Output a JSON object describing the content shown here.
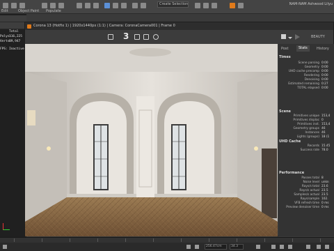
{
  "max": {
    "menu": [
      "Edit",
      "Object Paint",
      "Populate"
    ],
    "selection_set": "Create Selection Se",
    "title_right": "NAM-NAM  Ashwood  Lilyu",
    "stats": {
      "header": "Total",
      "polys_label": "Polys:",
      "polys_value": "116,225",
      "verts_label": "Verts:",
      "verts_value": "89,947",
      "fps_label": "FPS:",
      "fps_value": "Inactive"
    }
  },
  "vfb": {
    "title": "Corona 13 (Hotfix 1) | 1920x1440px (1:1) | Camera: CoronaCamera001 | Frame 0",
    "toolbar_number": "3",
    "channel": "BEAUTY",
    "tabs": [
      "Post",
      "Stats",
      "History"
    ],
    "active_tab": "Stats",
    "sections": {
      "times": {
        "title": "Times",
        "rows": [
          {
            "k": "Scene parsing",
            "v": "0:00"
          },
          {
            "k": "Geometry",
            "v": "0:00"
          },
          {
            "k": "UHD cache precomp",
            "v": "0:00"
          },
          {
            "k": "Rendering",
            "v": "0:00"
          },
          {
            "k": "Denoising",
            "v": "0:00"
          },
          {
            "k": "Estimated remaining",
            "v": "0:27"
          },
          {
            "k": "TOTAL elapsed",
            "v": "0:00"
          }
        ]
      },
      "scene": {
        "title": "Scene",
        "rows": [
          {
            "k": "Primitives unique",
            "v": "153,4"
          },
          {
            "k": "Primitives displac",
            "v": "0"
          },
          {
            "k": "Primitives inst.",
            "v": "153,4"
          },
          {
            "k": "Geometry groups",
            "v": "46"
          },
          {
            "k": "Instances",
            "v": "46"
          },
          {
            "k": "Lights (groups)",
            "v": "18 (1"
          }
        ]
      },
      "uhd": {
        "title": "UHD Cache",
        "rows": [
          {
            "k": "Records",
            "v": "15.45"
          },
          {
            "k": "Success rate",
            "v": "78.0"
          }
        ]
      },
      "performance": {
        "title": "Performance",
        "rows": [
          {
            "k": "Passes total",
            "v": "8"
          },
          {
            "k": "Noise level",
            "v": "unkn"
          },
          {
            "k": "Rays/s total",
            "v": "23.6"
          },
          {
            "k": "Rays/s actual",
            "v": "23.5"
          },
          {
            "k": "Samples/s actual",
            "v": "23.5"
          },
          {
            "k": "Rays/sample",
            "v": "102."
          },
          {
            "k": "VFB refresh time",
            "v": "0 ms"
          },
          {
            "k": "Preview denoiser time",
            "v": "0 ms"
          }
        ]
      }
    }
  },
  "timeline": {
    "coord_x": "256.47cm",
    "coord_y": "34.3"
  },
  "colors": {
    "accent_orange": "#e07a1a",
    "panel_bg": "#333333",
    "floor_wood": "#8a6a45",
    "wall": "#dcd8d1"
  }
}
